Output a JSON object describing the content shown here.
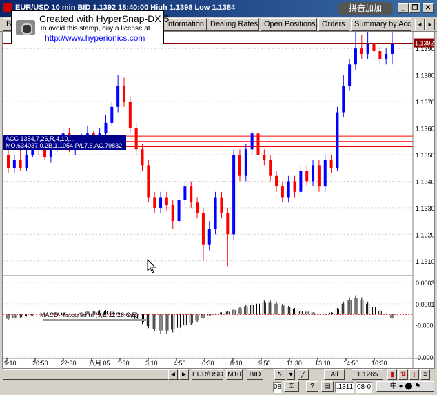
{
  "titlebar": {
    "title": "EUR/USD 10 min BID 1.1392 18:40:00 High 1.1398 Low 1.1384",
    "ime_text": "拼音加加",
    "min_label": "_",
    "restore_label": "❐",
    "close_label": "✕"
  },
  "stamp": {
    "line1": "Created with HyperSnap-DX 5",
    "line2": "To avoid this stamp, buy a license at",
    "line3": "http://www.hyperionics.com"
  },
  "tabs": {
    "partial_label": "B",
    "labels": [
      "Information",
      "Dealing Rates",
      "Open Positions",
      "Orders",
      "Summary by Acc"
    ]
  },
  "chart": {
    "price_badge": "1.1392",
    "top_axis_label": "1.1390",
    "price_labels": [
      "1.1380",
      "1.1370",
      "1.1360",
      "1.1350",
      "1.1340",
      "1.1330",
      "1.1320",
      "1.1310"
    ],
    "info_line1": "ACC 1354,7,26,R,4,10,...",
    "info_line2": "MO,634037,0.2B,1.1054,P/L7.6,AC.79832",
    "macd_label": "MACD-Histogramm (9,E,12,26,C,E)",
    "macd_axis_labels": [
      "0.0003",
      "0.0001",
      "-0.0001",
      "-0.0004"
    ],
    "time_labels": [
      "9:10",
      "20:50",
      "22:30",
      "八月.05",
      "1:30",
      "3:10",
      "4:50",
      "6:30",
      "8:10",
      "9:50",
      "11:30",
      "13:10",
      "14:50",
      "16:30"
    ]
  },
  "chart_data": {
    "type": "candlestick",
    "symbol": "EUR/USD",
    "interval": "10 min",
    "ylim": [
      1.1305,
      1.1395
    ],
    "series": [
      {
        "name": "candles",
        "values": [
          [
            1.135,
            1.1345,
            1.1352,
            1.1343
          ],
          [
            1.1345,
            1.1348,
            1.135,
            1.1343
          ],
          [
            1.1348,
            1.1345,
            1.1352,
            1.1344
          ],
          [
            1.1345,
            1.135,
            1.1352,
            1.1344
          ],
          [
            1.135,
            1.1354,
            1.1356,
            1.1349
          ],
          [
            1.1354,
            1.1352,
            1.1357,
            1.135
          ],
          [
            1.1352,
            1.1349,
            1.1354,
            1.1348
          ],
          [
            1.1349,
            1.1352,
            1.1353,
            1.1347
          ],
          [
            1.1352,
            1.1354,
            1.1356,
            1.1351
          ],
          [
            1.1354,
            1.1358,
            1.136,
            1.1352
          ],
          [
            1.1358,
            1.1352,
            1.136,
            1.1351
          ],
          [
            1.1352,
            1.1353,
            1.1355,
            1.135
          ],
          [
            1.1353,
            1.1356,
            1.1358,
            1.1352
          ],
          [
            1.1356,
            1.1358,
            1.1361,
            1.1354
          ],
          [
            1.1358,
            1.1354,
            1.1359,
            1.1352
          ],
          [
            1.1354,
            1.1358,
            1.136,
            1.1352
          ],
          [
            1.1358,
            1.1362,
            1.1365,
            1.1356
          ],
          [
            1.1362,
            1.1368,
            1.137,
            1.1361
          ],
          [
            1.1368,
            1.1376,
            1.138,
            1.1366
          ],
          [
            1.1376,
            1.137,
            1.1379,
            1.1368
          ],
          [
            1.137,
            1.136,
            1.1372,
            1.1358
          ],
          [
            1.136,
            1.1352,
            1.1362,
            1.135
          ],
          [
            1.1352,
            1.1346,
            1.1354,
            1.1344
          ],
          [
            1.1346,
            1.1334,
            1.1348,
            1.1332
          ],
          [
            1.1334,
            1.133,
            1.1336,
            1.1328
          ],
          [
            1.133,
            1.1334,
            1.1336,
            1.1328
          ],
          [
            1.1334,
            1.1331,
            1.1336,
            1.1329
          ],
          [
            1.1331,
            1.1325,
            1.1333,
            1.1322
          ],
          [
            1.1325,
            1.1333,
            1.1336,
            1.1323
          ],
          [
            1.1333,
            1.1338,
            1.134,
            1.1331
          ],
          [
            1.1338,
            1.1332,
            1.134,
            1.133
          ],
          [
            1.1332,
            1.1328,
            1.1334,
            1.1326
          ],
          [
            1.1328,
            1.1316,
            1.133,
            1.131
          ],
          [
            1.1316,
            1.1322,
            1.1325,
            1.1314
          ],
          [
            1.1322,
            1.1334,
            1.1336,
            1.132
          ],
          [
            1.1334,
            1.1328,
            1.1336,
            1.1326
          ],
          [
            1.1328,
            1.132,
            1.133,
            1.1308
          ],
          [
            1.132,
            1.135,
            1.1352,
            1.1318
          ],
          [
            1.135,
            1.1342,
            1.1352,
            1.134
          ],
          [
            1.1342,
            1.1352,
            1.1354,
            1.134
          ],
          [
            1.1352,
            1.1358,
            1.1359,
            1.135
          ],
          [
            1.1358,
            1.135,
            1.1359,
            1.1348
          ],
          [
            1.135,
            1.1348,
            1.1352,
            1.1346
          ],
          [
            1.1348,
            1.1342,
            1.135,
            1.134
          ],
          [
            1.1342,
            1.1338,
            1.1344,
            1.1336
          ],
          [
            1.1338,
            1.1334,
            1.134,
            1.1332
          ],
          [
            1.1334,
            1.134,
            1.1342,
            1.1332
          ],
          [
            1.134,
            1.1336,
            1.1342,
            1.1334
          ],
          [
            1.1336,
            1.1344,
            1.1346,
            1.1335
          ],
          [
            1.1344,
            1.134,
            1.1346,
            1.1338
          ],
          [
            1.134,
            1.1346,
            1.1348,
            1.1338
          ],
          [
            1.1346,
            1.1338,
            1.1348,
            1.1336
          ],
          [
            1.1338,
            1.1348,
            1.135,
            1.1336
          ],
          [
            1.1348,
            1.1345,
            1.135,
            1.1343
          ],
          [
            1.1345,
            1.1366,
            1.1368,
            1.1344
          ],
          [
            1.1366,
            1.1376,
            1.138,
            1.1364
          ],
          [
            1.1376,
            1.1384,
            1.1386,
            1.1374
          ],
          [
            1.1384,
            1.139,
            1.1397,
            1.1382
          ],
          [
            1.139,
            1.1388,
            1.1395,
            1.1386
          ],
          [
            1.1388,
            1.1392,
            1.1396,
            1.1386
          ],
          [
            1.1392,
            1.1389,
            1.1396,
            1.1385
          ],
          [
            1.1389,
            1.1386,
            1.1391,
            1.1384
          ],
          [
            1.1386,
            1.1388,
            1.139,
            1.1384
          ],
          [
            1.1388,
            1.1392,
            1.1398,
            1.1384
          ]
        ]
      },
      {
        "name": "MACD",
        "values": [
          -5e-05,
          -4e-05,
          -3e-05,
          -2e-05,
          -1e-05,
          0.0,
          1e-05,
          1e-05,
          2e-05,
          2e-05,
          1e-05,
          1e-05,
          2e-05,
          3e-05,
          3e-05,
          4e-05,
          4e-05,
          3e-05,
          2e-05,
          1e-05,
          -2e-05,
          -5e-05,
          -9e-05,
          -0.00013,
          -0.00016,
          -0.00018,
          -0.00018,
          -0.00017,
          -0.00015,
          -0.00012,
          -0.0001,
          -7e-05,
          -4e-05,
          -1e-05,
          1e-05,
          2e-05,
          3e-05,
          5e-05,
          7e-05,
          9e-05,
          0.00011,
          0.00012,
          0.00013,
          0.00013,
          0.00012,
          0.0001,
          8e-05,
          6e-05,
          4e-05,
          3e-05,
          2e-05,
          1e-05,
          1e-05,
          2e-05,
          6e-05,
          0.00012,
          0.00016,
          0.00018,
          0.00016,
          0.00012,
          8e-05,
          4e-05,
          1e-05,
          -4e-05
        ]
      }
    ],
    "horizontal_levels": [
      1.1357,
      1.1355,
      1.1353
    ]
  },
  "bottombar": {
    "nav_left": "◄",
    "nav_right": "►",
    "symbol": "EUR/USD",
    "interval": "M10",
    "side": "BID",
    "all_label": "All",
    "price": "1.1265",
    "field1": "08",
    "field2": ".1311",
    "field3": "08-0"
  },
  "colors": {
    "up": "#0000ff",
    "down": "#ff0000",
    "price_badge_bg": "#8b0000",
    "title_bg": "#0a246a"
  }
}
